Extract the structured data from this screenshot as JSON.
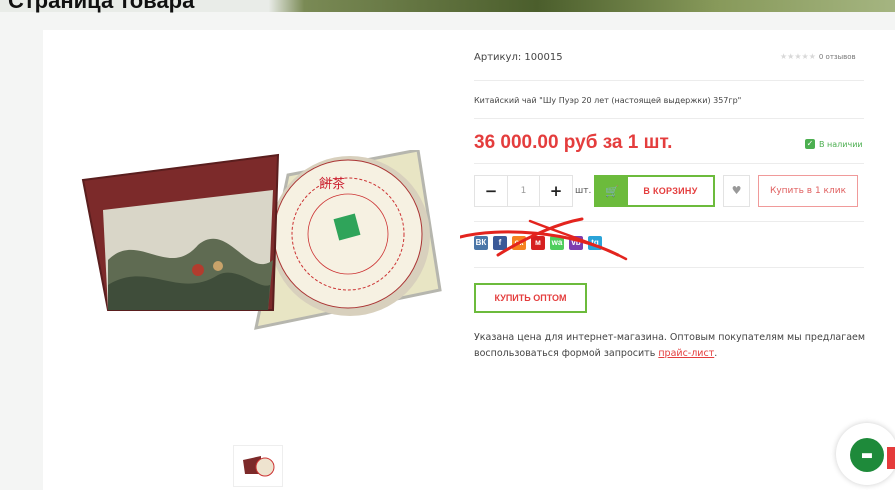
{
  "page_heading": "Страница товара",
  "product": {
    "sku": "Артикул: 100015",
    "reviews": "0 отзывов",
    "title": "Китайский чай \"Шу Пуэр 20 лет (настоящей выдержки) 357гр\"",
    "price": "36 000.00 руб за 1 шт.",
    "stock": "В наличии"
  },
  "purchase": {
    "minus": "−",
    "qty": "1",
    "plus": "+",
    "unit": "шт.",
    "cart_label": "В КОРЗИНУ",
    "one_click": "Купить в 1 клик"
  },
  "social": [
    "ВК",
    "f",
    "ок",
    "м",
    "wa",
    "vb",
    "tg"
  ],
  "wholesale_label": "КУПИТЬ ОПТОМ",
  "notice": {
    "text": "Указана цена для интернет-магазина. Оптовым покупателям мы предлагаем воспользоваться формой запросить",
    "link": "прайс-лист",
    "tail": "."
  },
  "colors": {
    "accent_red": "#e43d3d",
    "accent_green": "#6cbb3c",
    "chat_green": "#1e8a3a"
  },
  "icons": [
    "cart-icon",
    "heart-icon",
    "check-icon",
    "chat-icon",
    "star-icon"
  ]
}
